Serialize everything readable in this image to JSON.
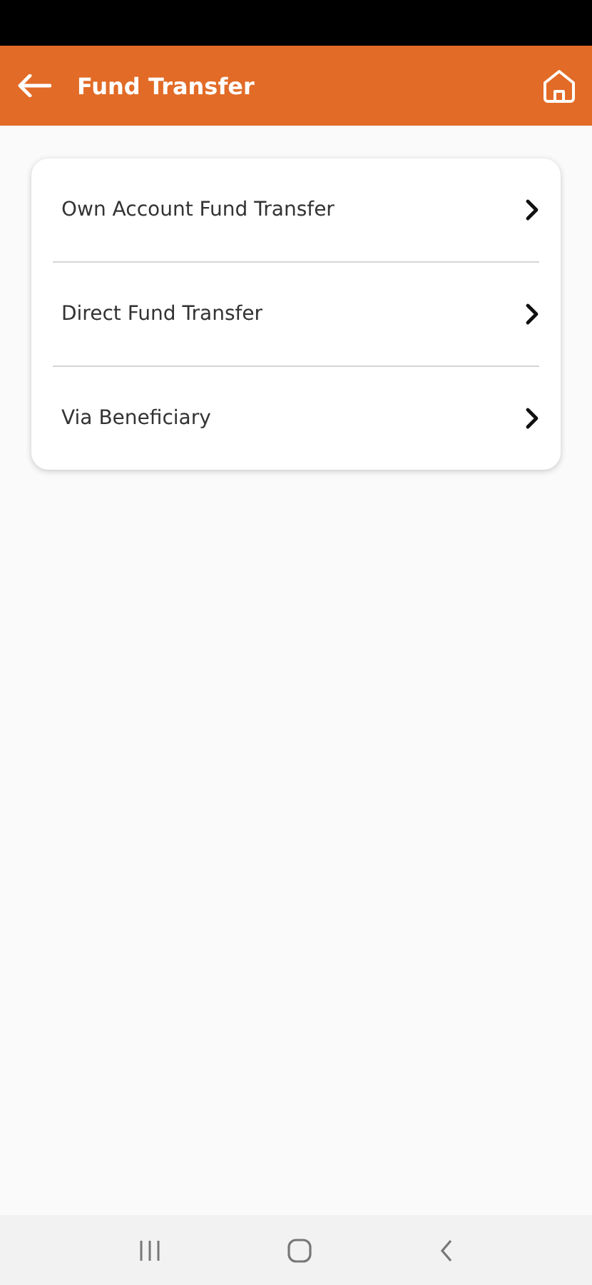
{
  "header": {
    "title": "Fund Transfer"
  },
  "menu": [
    {
      "label": "Own Account Fund Transfer"
    },
    {
      "label": "Direct Fund Transfer"
    },
    {
      "label": "Via Beneficiary"
    }
  ]
}
